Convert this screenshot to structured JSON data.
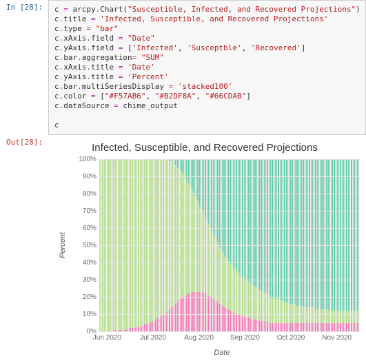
{
  "cell": {
    "in_prompt": "In [28]:",
    "out_prompt": "Out[28]:",
    "code_segments": [
      {
        "t": "var",
        "v": "c"
      },
      {
        "t": "txt",
        "v": " "
      },
      {
        "t": "op",
        "v": "="
      },
      {
        "t": "txt",
        "v": " arcpy"
      },
      {
        "t": "dot",
        "v": "."
      },
      {
        "t": "call",
        "v": "Chart"
      },
      {
        "t": "txt",
        "v": "("
      },
      {
        "t": "str",
        "v": "\"Susceptible, Infected, and Recovered Projections\""
      },
      {
        "t": "txt",
        "v": ")\n"
      },
      {
        "t": "var",
        "v": "c"
      },
      {
        "t": "dot",
        "v": "."
      },
      {
        "t": "attr",
        "v": "title"
      },
      {
        "t": "txt",
        "v": " "
      },
      {
        "t": "op",
        "v": "="
      },
      {
        "t": "txt",
        "v": " "
      },
      {
        "t": "str",
        "v": "'Infected, Susceptible, and Recovered Projections'"
      },
      {
        "t": "txt",
        "v": "\n"
      },
      {
        "t": "var",
        "v": "c"
      },
      {
        "t": "dot",
        "v": "."
      },
      {
        "t": "attr",
        "v": "type"
      },
      {
        "t": "txt",
        "v": " "
      },
      {
        "t": "op",
        "v": "="
      },
      {
        "t": "txt",
        "v": " "
      },
      {
        "t": "str",
        "v": "\"bar\""
      },
      {
        "t": "txt",
        "v": "\n"
      },
      {
        "t": "var",
        "v": "c"
      },
      {
        "t": "dot",
        "v": "."
      },
      {
        "t": "attr",
        "v": "xAxis"
      },
      {
        "t": "dot",
        "v": "."
      },
      {
        "t": "attr",
        "v": "field"
      },
      {
        "t": "txt",
        "v": " "
      },
      {
        "t": "op",
        "v": "="
      },
      {
        "t": "txt",
        "v": " "
      },
      {
        "t": "str",
        "v": "\"Date\""
      },
      {
        "t": "txt",
        "v": "\n"
      },
      {
        "t": "var",
        "v": "c"
      },
      {
        "t": "dot",
        "v": "."
      },
      {
        "t": "attr",
        "v": "yAxis"
      },
      {
        "t": "dot",
        "v": "."
      },
      {
        "t": "attr",
        "v": "field"
      },
      {
        "t": "txt",
        "v": " "
      },
      {
        "t": "op",
        "v": "="
      },
      {
        "t": "txt",
        "v": " ["
      },
      {
        "t": "str",
        "v": "'Infected'"
      },
      {
        "t": "txt",
        "v": ", "
      },
      {
        "t": "str",
        "v": "'Susceptble'"
      },
      {
        "t": "txt",
        "v": ", "
      },
      {
        "t": "str",
        "v": "'Recovered'"
      },
      {
        "t": "txt",
        "v": "]\n"
      },
      {
        "t": "var",
        "v": "c"
      },
      {
        "t": "dot",
        "v": "."
      },
      {
        "t": "attr",
        "v": "bar"
      },
      {
        "t": "dot",
        "v": "."
      },
      {
        "t": "attr",
        "v": "aggregation"
      },
      {
        "t": "op",
        "v": "="
      },
      {
        "t": "txt",
        "v": " "
      },
      {
        "t": "str",
        "v": "\"SUM\""
      },
      {
        "t": "txt",
        "v": "\n"
      },
      {
        "t": "var",
        "v": "c"
      },
      {
        "t": "dot",
        "v": "."
      },
      {
        "t": "attr",
        "v": "xAxis"
      },
      {
        "t": "dot",
        "v": "."
      },
      {
        "t": "attr",
        "v": "title"
      },
      {
        "t": "txt",
        "v": " "
      },
      {
        "t": "op",
        "v": "="
      },
      {
        "t": "txt",
        "v": " "
      },
      {
        "t": "str",
        "v": "'Date'"
      },
      {
        "t": "txt",
        "v": "\n"
      },
      {
        "t": "var",
        "v": "c"
      },
      {
        "t": "dot",
        "v": "."
      },
      {
        "t": "attr",
        "v": "yAxis"
      },
      {
        "t": "dot",
        "v": "."
      },
      {
        "t": "attr",
        "v": "title"
      },
      {
        "t": "txt",
        "v": " "
      },
      {
        "t": "op",
        "v": "="
      },
      {
        "t": "txt",
        "v": " "
      },
      {
        "t": "str",
        "v": "'Percent'"
      },
      {
        "t": "txt",
        "v": "\n"
      },
      {
        "t": "var",
        "v": "c"
      },
      {
        "t": "dot",
        "v": "."
      },
      {
        "t": "attr",
        "v": "bar"
      },
      {
        "t": "dot",
        "v": "."
      },
      {
        "t": "attr",
        "v": "multiSeriesDisplay"
      },
      {
        "t": "txt",
        "v": " "
      },
      {
        "t": "op",
        "v": "="
      },
      {
        "t": "txt",
        "v": " "
      },
      {
        "t": "str",
        "v": "'stacked100'"
      },
      {
        "t": "txt",
        "v": "\n"
      },
      {
        "t": "var",
        "v": "c"
      },
      {
        "t": "dot",
        "v": "."
      },
      {
        "t": "attr",
        "v": "color"
      },
      {
        "t": "txt",
        "v": " "
      },
      {
        "t": "op",
        "v": "="
      },
      {
        "t": "txt",
        "v": " ["
      },
      {
        "t": "str",
        "v": "\"#F57AB6\""
      },
      {
        "t": "txt",
        "v": ", "
      },
      {
        "t": "str",
        "v": "\"#B2DF8A\""
      },
      {
        "t": "txt",
        "v": ", "
      },
      {
        "t": "str",
        "v": "\"#66CDAB\""
      },
      {
        "t": "txt",
        "v": "]\n"
      },
      {
        "t": "var",
        "v": "c"
      },
      {
        "t": "dot",
        "v": "."
      },
      {
        "t": "attr",
        "v": "dataSource"
      },
      {
        "t": "txt",
        "v": " "
      },
      {
        "t": "op",
        "v": "="
      },
      {
        "t": "txt",
        "v": " chime_output\n\n"
      },
      {
        "t": "var",
        "v": "c"
      }
    ]
  },
  "chart_data": {
    "type": "bar",
    "stacked": "100%",
    "title": "Infected, Susceptible, and Recovered Projections",
    "xlabel": "Date",
    "ylabel": "Percent",
    "ylim": [
      0,
      100
    ],
    "y_ticks": [
      "100%",
      "90%",
      "80%",
      "70%",
      "60%",
      "50%",
      "40%",
      "30%",
      "20%",
      "10%",
      "0%"
    ],
    "x_ticks": [
      "Jun 2020",
      "Jul 2020",
      "Aug 2020",
      "Sep 2020",
      "Oct 2020",
      "Nov 2020"
    ],
    "categories_range": [
      "2020-05-14",
      "2020-11-28"
    ],
    "colors": {
      "Infected": "#F57AB6",
      "Susceptible": "#B2DF8A",
      "Recovered": "#66CDAB"
    },
    "series": [
      {
        "name": "Infected",
        "values": [
          0,
          0,
          0,
          0,
          0,
          0,
          0,
          0,
          0,
          0,
          0,
          0,
          1,
          1,
          1,
          1,
          1,
          1,
          1,
          1,
          1,
          1,
          1,
          2,
          2,
          2,
          2,
          2,
          2,
          2,
          3,
          3,
          3,
          3,
          3,
          4,
          4,
          4,
          4,
          5,
          5,
          5,
          6,
          6,
          6,
          7,
          7,
          8,
          8,
          9,
          9,
          10,
          10,
          11,
          11,
          12,
          13,
          13,
          14,
          15,
          15,
          16,
          17,
          17,
          18,
          19,
          19,
          20,
          20,
          21,
          21,
          22,
          22,
          22,
          23,
          23,
          23,
          23,
          23,
          23,
          23,
          23,
          23,
          23,
          22,
          22,
          22,
          21,
          21,
          20,
          20,
          19,
          19,
          18,
          18,
          17,
          17,
          16,
          16,
          15,
          15,
          14,
          14,
          13,
          13,
          12,
          12,
          12,
          11,
          11,
          11,
          10,
          10,
          10,
          9,
          9,
          9,
          9,
          8,
          8,
          8,
          8,
          8,
          7,
          7,
          7,
          7,
          7,
          7,
          6,
          6,
          6,
          6,
          6,
          6,
          6,
          6,
          6,
          5,
          5,
          5,
          5,
          5,
          5,
          5,
          5,
          5,
          5,
          5,
          5,
          5,
          5,
          5,
          5,
          5,
          5,
          5,
          5,
          5,
          5,
          5,
          5,
          5,
          5,
          5,
          5,
          5,
          5,
          5,
          5,
          5,
          5,
          5,
          5,
          5,
          5,
          5,
          5,
          5,
          5,
          5,
          5,
          5,
          5,
          5,
          5,
          5,
          5,
          5,
          5,
          5,
          5,
          5,
          5,
          5,
          5,
          5,
          5,
          5,
          5,
          5,
          5,
          5,
          5,
          5,
          5,
          5,
          5,
          5,
          5
        ]
      },
      {
        "name": "Susceptible",
        "values": [
          100,
          100,
          100,
          100,
          100,
          100,
          100,
          100,
          100,
          99,
          99,
          99,
          99,
          99,
          99,
          99,
          99,
          99,
          99,
          99,
          99,
          99,
          99,
          98,
          98,
          98,
          98,
          98,
          98,
          98,
          97,
          97,
          97,
          97,
          97,
          96,
          96,
          96,
          96,
          95,
          95,
          95,
          94,
          94,
          94,
          93,
          93,
          92,
          92,
          91,
          91,
          90,
          90,
          89,
          89,
          87,
          86,
          86,
          85,
          84,
          82,
          81,
          80,
          78,
          77,
          75,
          74,
          72,
          71,
          69,
          67,
          66,
          64,
          63,
          61,
          59,
          58,
          56,
          55,
          53,
          52,
          50,
          49,
          48,
          47,
          45,
          44,
          43,
          42,
          41,
          40,
          39,
          38,
          37,
          36,
          35,
          34,
          33,
          32,
          32,
          31,
          30,
          29,
          29,
          28,
          28,
          27,
          27,
          26,
          26,
          25,
          25,
          24,
          24,
          23,
          23,
          23,
          22,
          22,
          22,
          21,
          21,
          20,
          20,
          20,
          19,
          19,
          19,
          18,
          18,
          18,
          17,
          17,
          17,
          16,
          16,
          16,
          15,
          15,
          15,
          15,
          14,
          14,
          14,
          14,
          13,
          13,
          13,
          13,
          12,
          12,
          12,
          12,
          12,
          11,
          11,
          11,
          11,
          11,
          10,
          10,
          10,
          10,
          10,
          10,
          10,
          9,
          9,
          9,
          9,
          9,
          9,
          9,
          9,
          8,
          8,
          8,
          8,
          8,
          8,
          8,
          8,
          8,
          8,
          8,
          8,
          7,
          7,
          7,
          7,
          7,
          7,
          7,
          7,
          7,
          7,
          7,
          7,
          7,
          7,
          7,
          7,
          7,
          7,
          7,
          7,
          7,
          7,
          7,
          7
        ]
      },
      {
        "name": "Recovered",
        "values": [
          0,
          0,
          0,
          0,
          0,
          0,
          0,
          0,
          0,
          1,
          1,
          1,
          0,
          0,
          0,
          0,
          0,
          0,
          0,
          0,
          0,
          0,
          0,
          0,
          0,
          0,
          0,
          0,
          0,
          0,
          0,
          0,
          0,
          0,
          0,
          0,
          0,
          0,
          0,
          0,
          0,
          0,
          0,
          0,
          0,
          0,
          0,
          0,
          0,
          0,
          0,
          0,
          0,
          0,
          0,
          1,
          1,
          1,
          1,
          1,
          3,
          3,
          3,
          5,
          5,
          6,
          7,
          8,
          9,
          10,
          12,
          12,
          14,
          15,
          16,
          18,
          19,
          21,
          22,
          24,
          25,
          27,
          28,
          29,
          31,
          33,
          34,
          36,
          37,
          39,
          40,
          42,
          43,
          45,
          46,
          48,
          49,
          51,
          52,
          53,
          54,
          56,
          57,
          58,
          59,
          60,
          61,
          61,
          63,
          63,
          64,
          65,
          66,
          66,
          68,
          68,
          68,
          69,
          70,
          70,
          71,
          71,
          72,
          73,
          73,
          74,
          74,
          74,
          75,
          76,
          76,
          77,
          77,
          77,
          78,
          78,
          78,
          79,
          80,
          80,
          80,
          81,
          81,
          81,
          81,
          82,
          82,
          82,
          82,
          83,
          83,
          83,
          83,
          83,
          84,
          84,
          84,
          84,
          84,
          85,
          85,
          85,
          85,
          85,
          85,
          85,
          86,
          86,
          86,
          86,
          86,
          86,
          86,
          86,
          87,
          87,
          87,
          87,
          87,
          87,
          87,
          87,
          87,
          87,
          87,
          87,
          88,
          88,
          88,
          88,
          88,
          88,
          88,
          88,
          88,
          88,
          88,
          88,
          88,
          88,
          88,
          88,
          88,
          88,
          88,
          88,
          88,
          88,
          88,
          88
        ]
      }
    ]
  }
}
